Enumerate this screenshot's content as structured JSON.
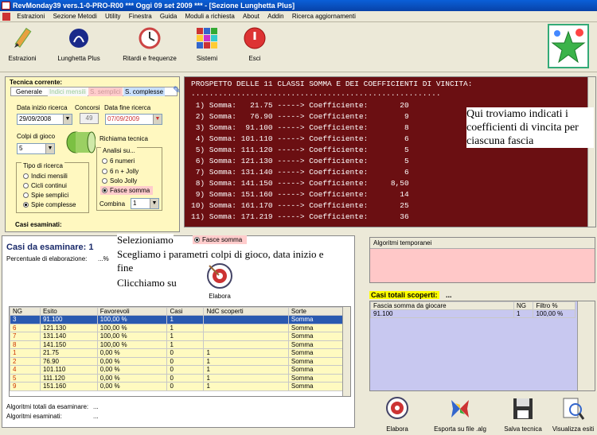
{
  "window": {
    "title": "RevMonday39 vers.1-0-PRO-R00   ***   Oggi 09 set 2009   ***   - [Sezione Lunghetta Plus]"
  },
  "menu": [
    "Estrazioni",
    "Sezione Metodi",
    "Utility",
    "Finestra",
    "Guida",
    "Moduli a richiesta",
    "About",
    "Addin",
    "Ricerca aggiornamenti"
  ],
  "toolbar": {
    "estrazioni": "Estrazioni",
    "lunghetta": "Lunghetta Plus",
    "ritardi": "Ritardi e frequenze",
    "sistemi": "Sistemi",
    "esci": "Esci"
  },
  "left": {
    "title": "Tecnica corrente:",
    "tabs": [
      "Generale",
      "Indici mensili",
      "S. semplici",
      "S. complesse"
    ],
    "data_inizio_label": "Data inizio ricerca",
    "data_inizio": "29/09/2008",
    "concorsi_label": "Concorsi",
    "concorsi": "49",
    "data_fine_label": "Data fine ricerca",
    "data_fine": "07/09/2009",
    "colpi_label": "Colpi di gioco",
    "colpi": "5",
    "richiama": "Richiama tecnica",
    "tipo_label": "Tipo di ricerca",
    "tipo": [
      "Indici mensili",
      "Cicli continui",
      "Spie semplici",
      "Spie complesse"
    ],
    "analisi_label": "Analisi su...",
    "analisi": [
      "6 numeri",
      "6 n + Jolly",
      "Solo Jolly",
      "Fasce somma"
    ],
    "combina_label": "Combina",
    "combina": "1",
    "casi_esaminati": "Casi esaminati:"
  },
  "console": {
    "header": "PROSPETTO DELLE 11 CLASSI SOMMA E DEI COEFFICIENTI DI VINCITA:",
    "dots": ".......................................................",
    "lines": [
      " 1) Somma:   21.75 -----> Coefficiente:       20",
      " 2) Somma:   76.90 -----> Coefficiente:        9",
      " 3) Somma:  91.100 -----> Coefficiente:        8",
      " 4) Somma: 101.110 -----> Coefficiente:        6",
      " 5) Somma: 111.120 -----> Coefficiente:        5",
      " 6) Somma: 121.130 -----> Coefficiente:        5",
      " 7) Somma: 131.140 -----> Coefficiente:        6",
      " 8) Somma: 141.150 -----> Coefficiente:     8,50",
      " 9) Somma: 151.160 -----> Coefficiente:       14",
      "10) Somma: 161.170 -----> Coefficiente:       25",
      "11) Somma: 171.219 -----> Coefficiente:       36"
    ]
  },
  "annotation_top": "Qui troviamo indicati i coefficienti di vincita per ciascuna fascia",
  "annotation_mid": {
    "line1": "Selezioniamo",
    "radio": "Fasce somma",
    "line2": "Scegliamo i parametri colpi di gioco, data inizio e fine",
    "line3": "Clicchiamo su",
    "elabora": "Elabora"
  },
  "bottom": {
    "casi_title": "Casi da esaminare: 1",
    "percentuale": "Percentuale di elaborazione:",
    "percentuale_val": "...%",
    "headers": [
      "NG",
      "Esito",
      "Favorevoli",
      "Casi",
      "NdC scoperti",
      "Sorte"
    ],
    "rows": [
      [
        "3",
        "91.100",
        "100,00 %",
        "1",
        "",
        "Somma"
      ],
      [
        "6",
        "121.130",
        "100,00 %",
        "1",
        "",
        "Somma"
      ],
      [
        "7",
        "131.140",
        "100,00 %",
        "1",
        "",
        "Somma"
      ],
      [
        "8",
        "141.150",
        "100,00 %",
        "1",
        "",
        "Somma"
      ],
      [
        "1",
        "21.75",
        "0,00 %",
        "0",
        "1",
        "Somma"
      ],
      [
        "2",
        "76.90",
        "0,00 %",
        "0",
        "1",
        "Somma"
      ],
      [
        "4",
        "101.110",
        "0,00 %",
        "0",
        "1",
        "Somma"
      ],
      [
        "5",
        "111.120",
        "0,00 %",
        "0",
        "1",
        "Somma"
      ],
      [
        "9",
        "151.160",
        "0,00 %",
        "0",
        "1",
        "Somma"
      ]
    ],
    "alg_tot": "Algoritmi totali da esaminare:",
    "alg_tot_val": "...",
    "alg_esam": "Algoritmi esaminati:",
    "alg_esam_val": "..."
  },
  "right": {
    "alg_temp": "Algoritmi temporanei",
    "casi_totali": "Casi totali scoperti:",
    "casi_totali_val": "...",
    "headers": [
      "Fascia somma da giocare",
      "NG",
      "Filtro %"
    ],
    "row": [
      "91.100",
      "1",
      "100,00 %"
    ]
  },
  "buttons": {
    "elabora": "Elabora",
    "esporta": "Esporta su file .alg",
    "salva": "Salva tecnica",
    "visualizza": "Visualizza esiti"
  }
}
